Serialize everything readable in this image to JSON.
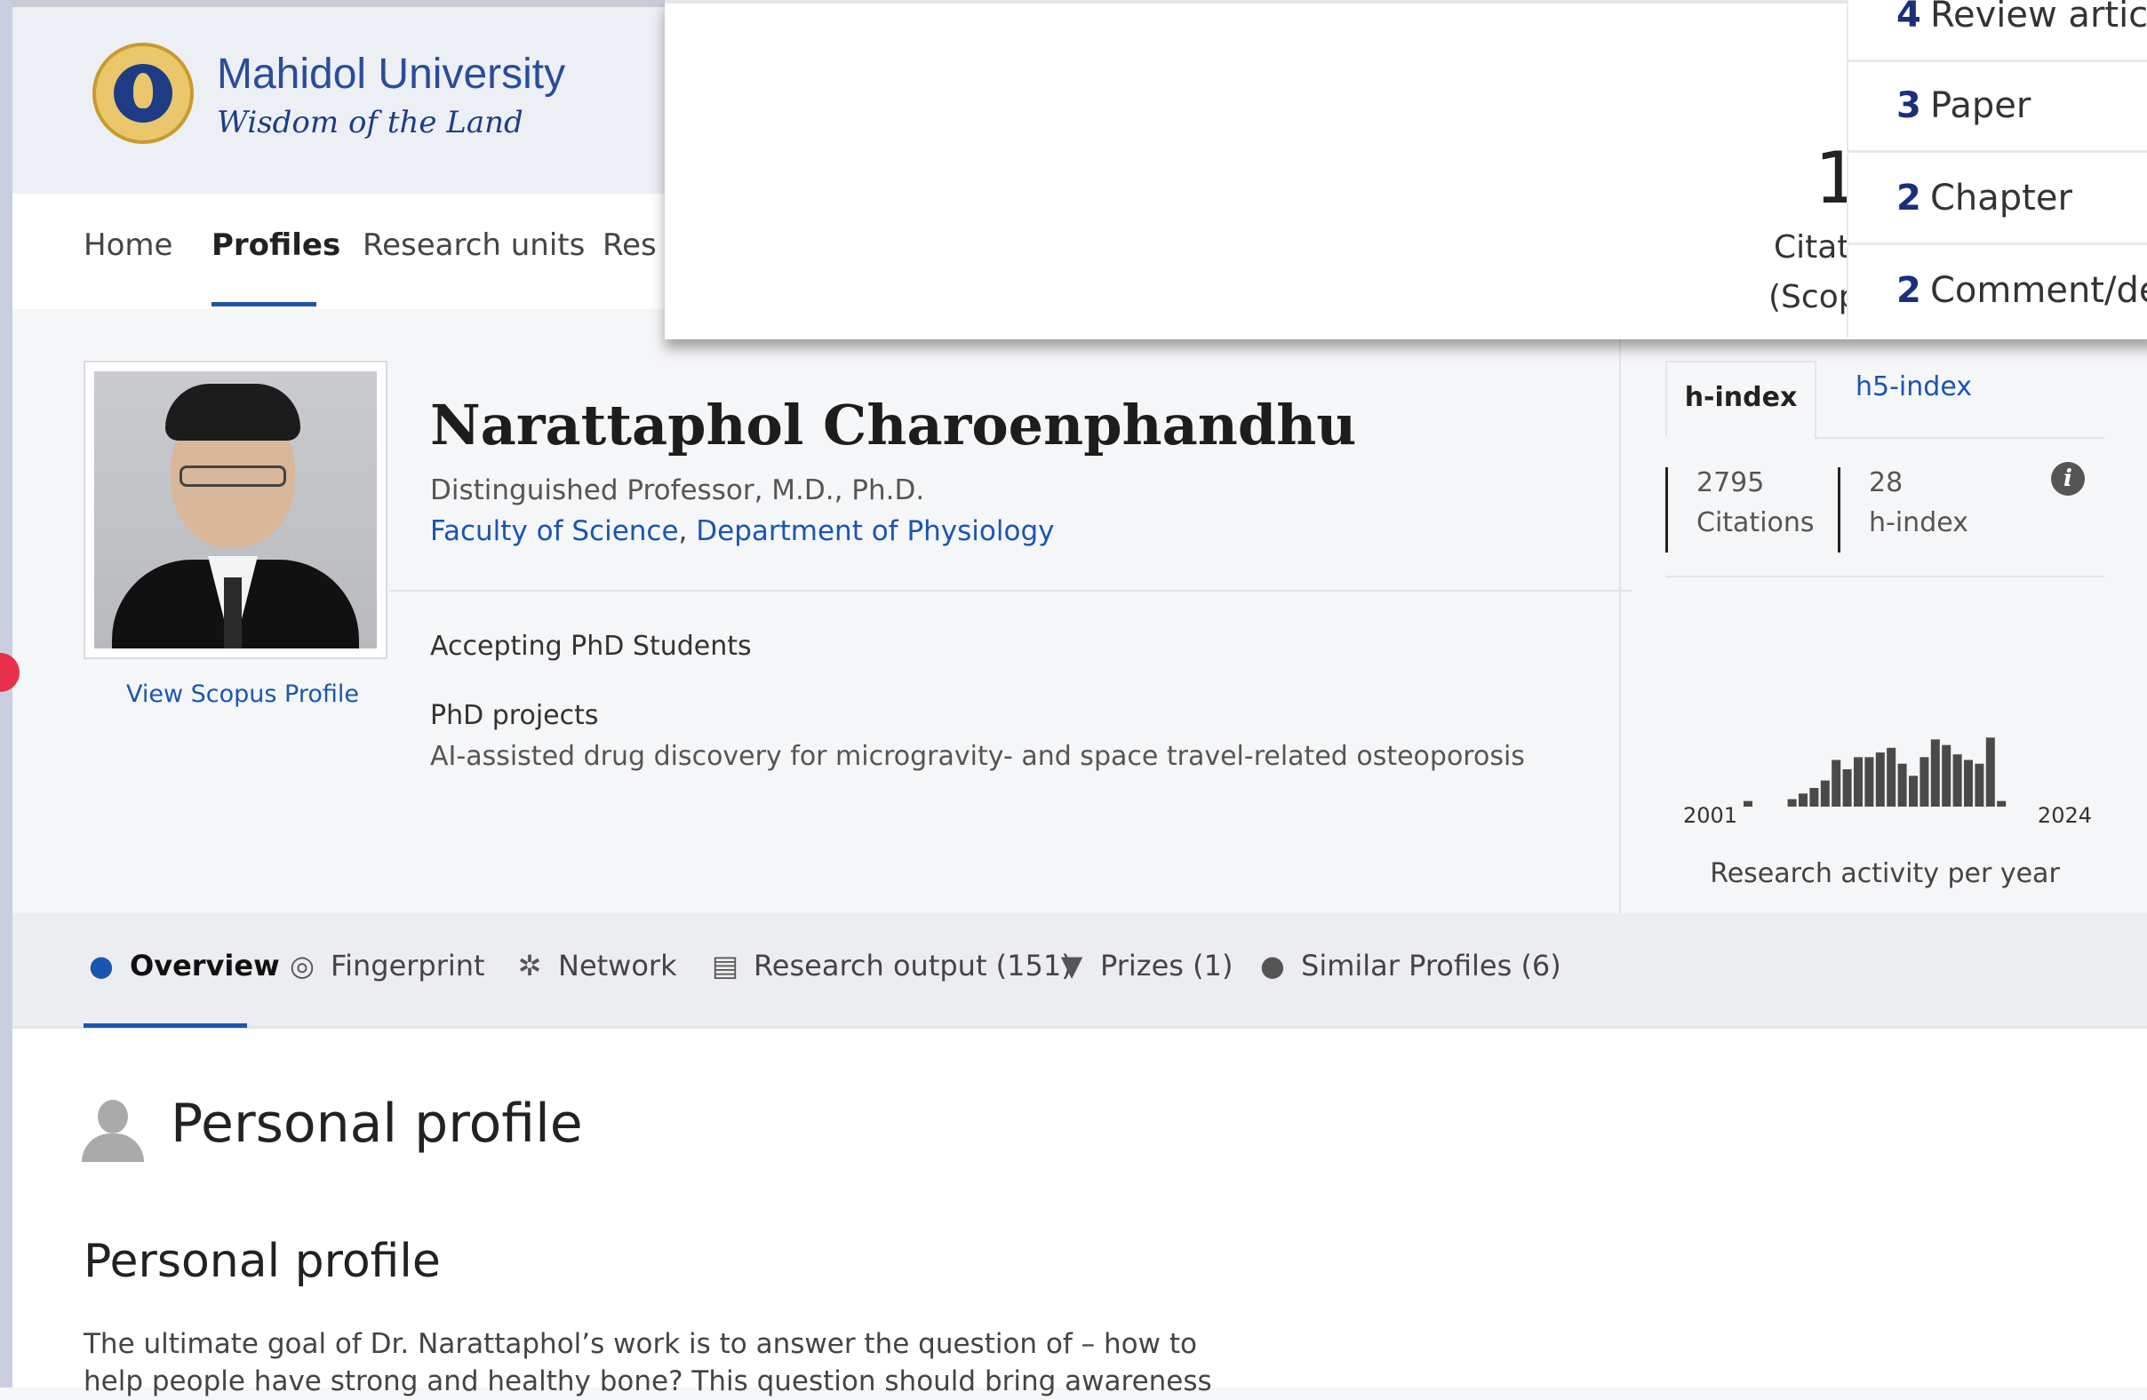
{
  "header": {
    "logo_name": "Mahidol University",
    "logo_tagline": "Wisdom of the Land"
  },
  "nav": {
    "items": [
      {
        "label": "Home"
      },
      {
        "label": "Profiles"
      },
      {
        "label": "Research units"
      },
      {
        "label": "Res"
      }
    ],
    "active": "Profiles"
  },
  "popup": {
    "big_number": "1",
    "citations_line1": "Citat",
    "citations_line2": "(Scop",
    "list": [
      {
        "count": "4",
        "label": "Review article"
      },
      {
        "count": "3",
        "label": "Paper"
      },
      {
        "count": "2",
        "label": "Chapter"
      },
      {
        "count": "2",
        "label": "Comment/deba"
      }
    ]
  },
  "profile": {
    "name": "Narattaphol Charoenphandhu",
    "title": "Distinguished Professor, M.D., Ph.D.",
    "affiliation_1": "Faculty of Science",
    "affiliation_sep": ", ",
    "affiliation_2": "Department of Physiology",
    "scopus_link": "View Scopus Profile",
    "accepting": "Accepting PhD Students",
    "phd_projects_label": "PhD projects",
    "phd_projects_desc": "AI-assisted drug discovery for microgravity- and space travel-related osteoporosis"
  },
  "metrics": {
    "tabs": [
      {
        "label": "h-index"
      },
      {
        "label": "h5-index"
      }
    ],
    "active_tab": "h-index",
    "citations_value": "2795",
    "citations_label": "Citations",
    "hindex_value": "28",
    "hindex_label": "h-index",
    "info_glyph": "i",
    "activity_start": "2001",
    "activity_end": "2024",
    "activity_caption": "Research activity per year",
    "activity_bars": [
      0.06,
      0,
      0,
      0,
      0.08,
      0.14,
      0.2,
      0.28,
      0.5,
      0.4,
      0.53,
      0.53,
      0.58,
      0.63,
      0.46,
      0.33,
      0.53,
      0.72,
      0.66,
      0.56,
      0.5,
      0.46,
      0.74,
      0.06
    ]
  },
  "tabs": [
    {
      "label": "Overview",
      "icon": "person-icon"
    },
    {
      "label": "Fingerprint",
      "icon": "fingerprint-icon"
    },
    {
      "label": "Network",
      "icon": "network-icon"
    },
    {
      "label": "Research output (151)",
      "icon": "book-icon"
    },
    {
      "label": "Prizes (1)",
      "icon": "trophy-icon"
    },
    {
      "label": "Similar Profiles (6)",
      "icon": "similar-profiles-icon"
    }
  ],
  "content": {
    "heading": "Personal profile",
    "subheading": "Personal profile",
    "paragraph_line1": "The ultimate goal of Dr. Narattaphol’s work is to answer the question of – how to",
    "paragraph_line2": "help people have strong and healthy bone? This question should bring awareness"
  },
  "colors": {
    "link": "#1a55b2",
    "brand_navy": "#1b2f7a",
    "header_bg": "#eceff4",
    "accent_red": "#e8304a"
  }
}
